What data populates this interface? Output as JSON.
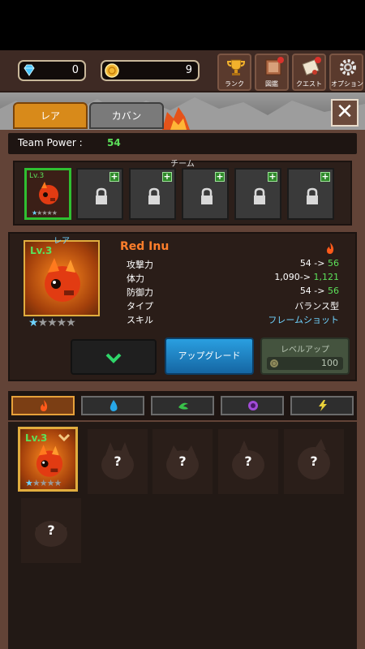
{
  "currencies": {
    "gems": "0",
    "gold": "9"
  },
  "menu": {
    "rank": "ランク",
    "book": "図鑑",
    "quest": "クエスト",
    "option": "オプション"
  },
  "tabs": {
    "rare": "レア",
    "bag": "カバン"
  },
  "close": "✕",
  "team_power": {
    "label": "Team Power :",
    "value": "54"
  },
  "team": {
    "label": "チーム",
    "hero_level": "Lv.3"
  },
  "hero": {
    "rarity": "レア",
    "level": "Lv.3",
    "name": "Red Inu",
    "stars": "★★★★★",
    "stats": [
      {
        "label": "攻撃力",
        "before": "54 ->",
        "after": " 56"
      },
      {
        "label": "体力",
        "before": "1,090->",
        "after": " 1,121"
      },
      {
        "label": "防御力",
        "before": "54 ->",
        "after": " 56"
      },
      {
        "label": "タイプ",
        "before": "バランス型",
        "after": ""
      },
      {
        "label": "スキル",
        "before": "",
        "after": "フレームショット"
      }
    ]
  },
  "buttons": {
    "expand": "❯",
    "upgrade": "アップグレード",
    "levelup": "レベルアップ",
    "levelup_cost": "100"
  },
  "collection": {
    "owned_level": "Lv.3",
    "owned_stars": "★★★★★",
    "unknown": "?"
  },
  "colors": {
    "fire": "#ff5a1a",
    "water": "#27a7e8",
    "wind": "#39c24a",
    "dark": "#a14bd6",
    "light": "#e9d13a",
    "accent_green": "#5ce05a"
  }
}
